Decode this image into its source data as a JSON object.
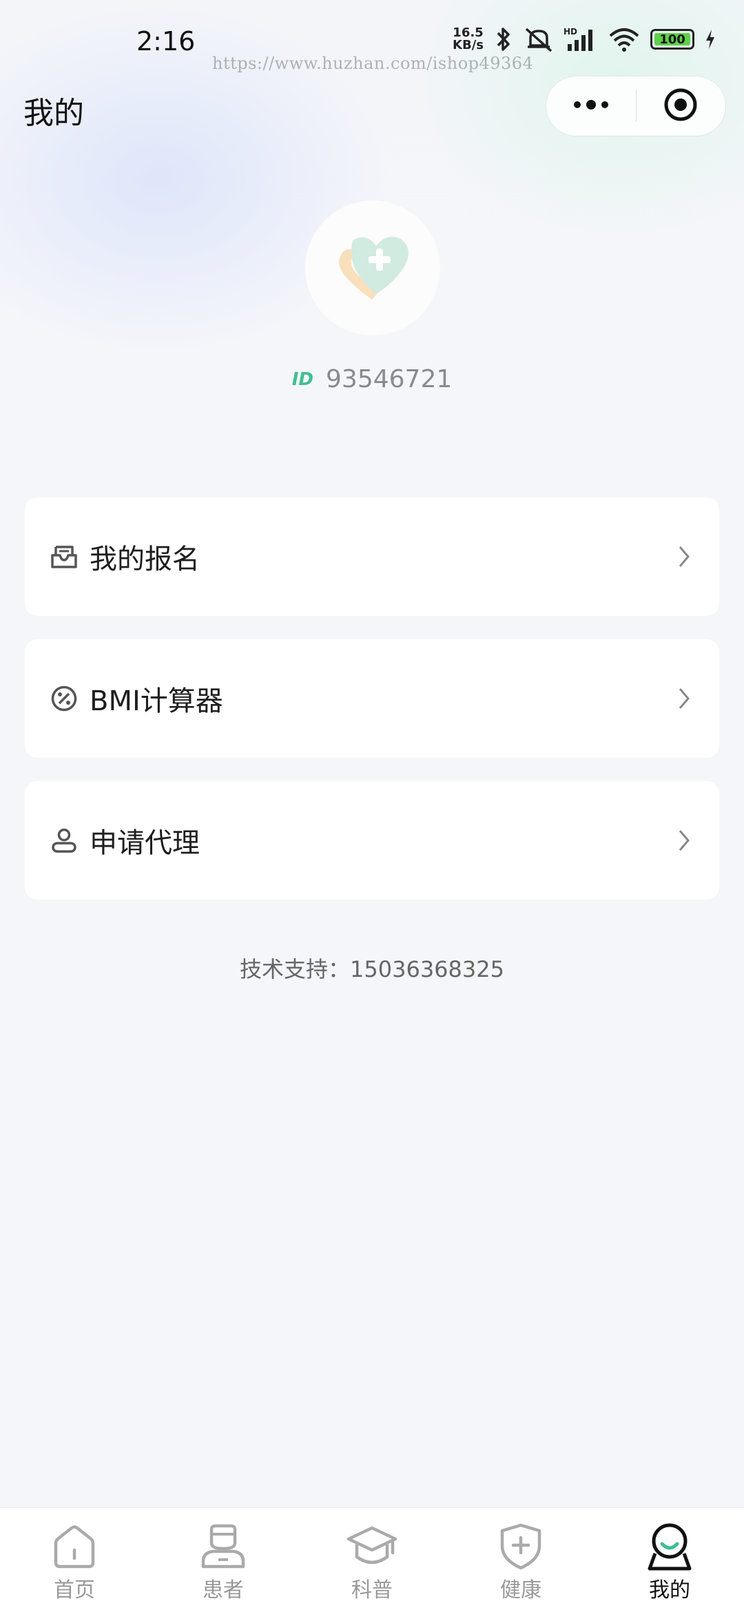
{
  "status_bar": {
    "time": "2:16",
    "net_speed_value": "16.5",
    "net_speed_unit": "KB/s",
    "battery": "100",
    "watermark": "https://www.huzhan.com/ishop49364"
  },
  "header": {
    "title": "我的",
    "more_icon": "more-dots-icon",
    "close_icon": "target-circle-icon"
  },
  "profile": {
    "id_badge": "ID",
    "id_value": "93546721"
  },
  "menu": {
    "items": [
      {
        "label": "我的报名",
        "icon": "inbox-tray-icon"
      },
      {
        "label": "BMI计算器",
        "icon": "percent-circle-icon"
      },
      {
        "label": "申请代理",
        "icon": "person-icon"
      }
    ]
  },
  "support_text": "技术支持：15036368325",
  "tabs": [
    {
      "label": "首页",
      "icon": "home-icon"
    },
    {
      "label": "患者",
      "icon": "patient-icon"
    },
    {
      "label": "科普",
      "icon": "graduation-cap-icon"
    },
    {
      "label": "健康",
      "icon": "health-shield-icon"
    },
    {
      "label": "我的",
      "icon": "profile-icon",
      "active": true
    }
  ],
  "colors": {
    "accent_green": "#3fbf8f",
    "background": "#f5f6fa",
    "battery_green": "#5fd04a"
  }
}
